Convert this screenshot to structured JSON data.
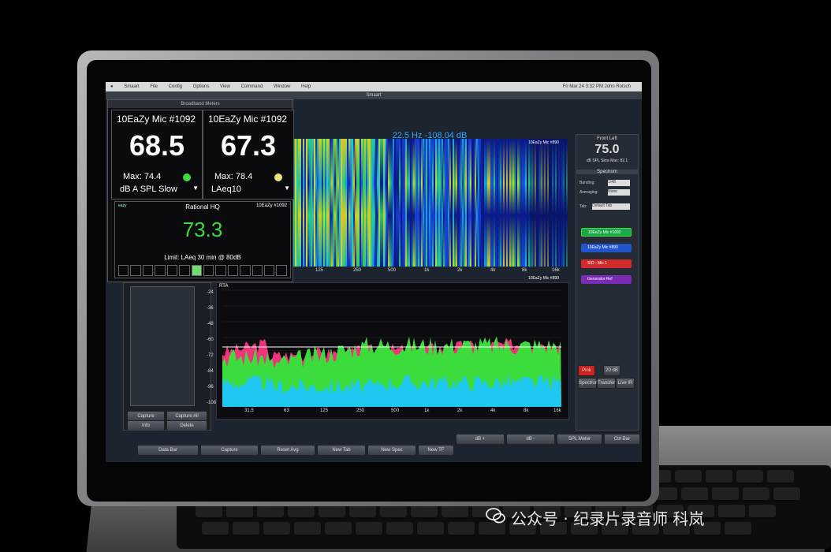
{
  "menubar": {
    "apple": "",
    "items": [
      "Smaart",
      "File",
      "Config",
      "Options",
      "View",
      "Command",
      "Window",
      "Help"
    ],
    "clock": "Fri Mar 24 3:32 PM   John Rotsch"
  },
  "window": {
    "title": "Smaart"
  },
  "meters": {
    "header": "Broadband Meters",
    "meter1": {
      "name": "10EaZy Mic #1092",
      "value": "68.5",
      "max": "Max: 74.4",
      "unit": "dB A SPL Slow",
      "dot_color": "#3ddc3d"
    },
    "meter2": {
      "name": "10EaZy Mic #1092",
      "value": "67.3",
      "max": "Max: 78.4",
      "unit": "LAeq10",
      "dot_color": "#f0e07a"
    },
    "rational": {
      "logo": "eazy",
      "title": "Rational HQ",
      "mic": "10EaZy #1092",
      "value": "73.3",
      "limit": "Limit: LAeq 30 min @ 80dB"
    }
  },
  "spectrograph": {
    "title": "22.5 Hz -108.04 dB",
    "label": "10EaZy Mic #890",
    "freq_ticks": [
      "125",
      "250",
      "500",
      "1k",
      "2k",
      "4k",
      "8k",
      "16k"
    ]
  },
  "rta": {
    "label": "RTA",
    "trace_label": "10EaZy Mic #890",
    "y_ticks": [
      "-24",
      "-36",
      "-48",
      "-60",
      "-72",
      "-84",
      "-96",
      "-108"
    ],
    "x_ticks": [
      "31.5",
      "63",
      "125",
      "250",
      "500",
      "1k",
      "2k",
      "4k",
      "8k",
      "16k"
    ]
  },
  "right_panel": {
    "header": "Front Left",
    "value": "75.0",
    "sub": "dB SPL Slow  Max: 82.1",
    "section": "Spectrum",
    "banding_label": "Banding:",
    "banding_value": "1/48",
    "averaging_label": "Averaging:",
    "averaging_value": "None",
    "tab_label": "Tab:",
    "tab_value": "Default Tab",
    "traces": [
      {
        "label": "10EaZy Mic #1092",
        "color": "#1aa84a"
      },
      {
        "label": "10EaZy Mic #890",
        "color": "#2255cc"
      },
      {
        "label": "SIO - Mic 1",
        "color": "#d22a2a"
      },
      {
        "label": "Generator Ref",
        "color": "#7a2ab5"
      }
    ],
    "buttons": [
      "Pink",
      "20 dB"
    ],
    "tabs": [
      "Spectrum",
      "Transfer",
      "Live IR"
    ]
  },
  "left_column": {
    "buttons": [
      "Capture",
      "Capture All",
      "Info",
      "Delete"
    ]
  },
  "bottom_buttons": {
    "row1": [
      "dB +",
      "dB -",
      "SPL Meter",
      "Ctrl Bar"
    ],
    "row2": [
      "Data Bar",
      "Capture",
      "Reset Avg",
      "New Tab",
      "New Spec",
      "New TF"
    ]
  },
  "watermark": {
    "text": "公众号 · 纪录片录音师 科岚"
  },
  "colors": {
    "green": "#3ddc3d",
    "cyan": "#1ec8f0",
    "magenta": "#f0347a",
    "accent_blue": "#2fa8ff"
  }
}
